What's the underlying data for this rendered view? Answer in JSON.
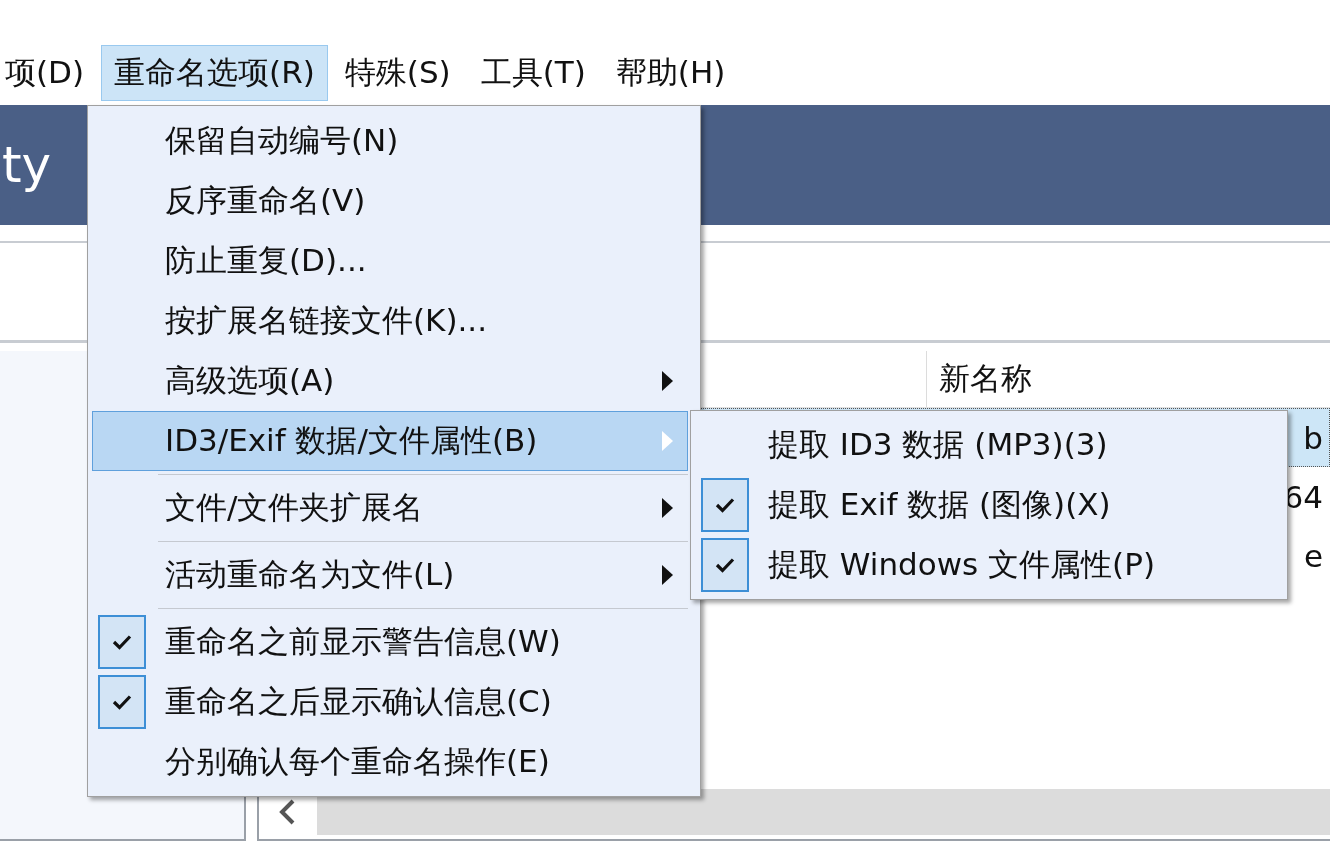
{
  "menubar": [
    {
      "label": "项(D)",
      "selected": false
    },
    {
      "label": "重命名选项(R)",
      "selected": true
    },
    {
      "label": "特殊(S)",
      "selected": false
    },
    {
      "label": "工具(T)",
      "selected": false
    },
    {
      "label": "帮助(H)",
      "selected": false
    }
  ],
  "header": {
    "title": "ty"
  },
  "file_list": {
    "columns": [
      {
        "label": "新名称"
      }
    ],
    "rows": [
      {
        "new_name": "b",
        "selected": true
      },
      {
        "new_name": "64",
        "selected": false
      },
      {
        "new_name": "e",
        "selected": false
      }
    ]
  },
  "menu": [
    {
      "kind": "item",
      "label": "保留自动编号(N)",
      "checked": false,
      "submenu": false,
      "selected": false
    },
    {
      "kind": "item",
      "label": "反序重命名(V)",
      "checked": false,
      "submenu": false,
      "selected": false
    },
    {
      "kind": "item",
      "label": "防止重复(D)...",
      "checked": false,
      "submenu": false,
      "selected": false
    },
    {
      "kind": "item",
      "label": "按扩展名链接文件(K)...",
      "checked": false,
      "submenu": false,
      "selected": false
    },
    {
      "kind": "item",
      "label": "高级选项(A)",
      "checked": false,
      "submenu": true,
      "selected": false
    },
    {
      "kind": "item",
      "label": "ID3/Exif 数据/文件属性(B)",
      "checked": false,
      "submenu": true,
      "selected": true
    },
    {
      "kind": "separator"
    },
    {
      "kind": "item",
      "label": "文件/文件夹扩展名",
      "checked": false,
      "submenu": true,
      "selected": false
    },
    {
      "kind": "separator"
    },
    {
      "kind": "item",
      "label": "活动重命名为文件(L)",
      "checked": false,
      "submenu": true,
      "selected": false
    },
    {
      "kind": "separator"
    },
    {
      "kind": "item",
      "label": "重命名之前显示警告信息(W)",
      "checked": true,
      "submenu": false,
      "selected": false
    },
    {
      "kind": "item",
      "label": "重命名之后显示确认信息(C)",
      "checked": true,
      "submenu": false,
      "selected": false
    },
    {
      "kind": "item",
      "label": "分别确认每个重命名操作(E)",
      "checked": false,
      "submenu": false,
      "selected": false
    }
  ],
  "submenu": [
    {
      "label": "提取 ID3 数据 (MP3)(3)",
      "checked": false
    },
    {
      "label": "提取 Exif 数据 (图像)(X)",
      "checked": true
    },
    {
      "label": "提取 Windows 文件属性(P)",
      "checked": true
    }
  ]
}
